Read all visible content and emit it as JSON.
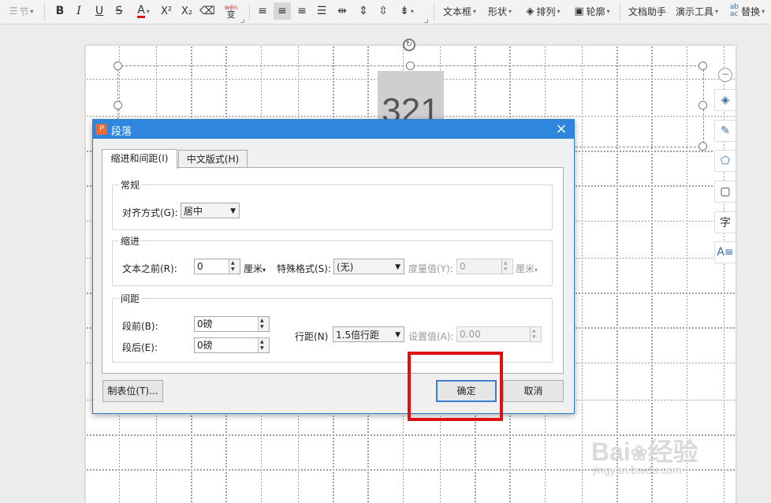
{
  "toolbar": {
    "section_label": "节",
    "bold": "B",
    "italic": "I",
    "underline": "U",
    "strike": "S",
    "font_color": "A",
    "superscript": "X²",
    "subscript": "X₂",
    "pinyin_top": "wén",
    "pinyin_bottom": "变",
    "textbox": "文本框",
    "shape": "形状",
    "arrange": "排列",
    "outline": "轮廓",
    "doc_helper": "文档助手",
    "present_tools": "演示工具",
    "replace": "替换"
  },
  "slide": {
    "text_box_content": "321"
  },
  "dialog": {
    "title": "段落",
    "close_glyph": "×",
    "tabs": [
      {
        "label": "缩进和间距(I)",
        "active": true
      },
      {
        "label": "中文版式(H)",
        "active": false
      }
    ],
    "general": {
      "title": "常规",
      "align_label": "对齐方式(G):",
      "align_value": "居中"
    },
    "indent": {
      "title": "缩进",
      "before_label": "文本之前(R):",
      "before_value": "0",
      "before_unit": "厘米",
      "special_label": "特殊格式(S):",
      "special_value": "(无)",
      "measure_label": "度量值(Y):",
      "measure_value": "0",
      "measure_unit": "厘米"
    },
    "spacing": {
      "title": "间距",
      "before_label": "段前(B):",
      "before_value": "0磅",
      "after_label": "段后(E):",
      "after_value": "0磅",
      "line_label": "行距(N)",
      "line_value": "1.5倍行距",
      "setting_label": "设置值(A):",
      "setting_value": "0.00"
    },
    "tabs_button": "制表位(T)...",
    "ok_button": "确定",
    "cancel_button": "取消"
  },
  "watermark": {
    "brand": "Bai",
    "brand_cn": "经验",
    "url": "jingyan.baidu.com"
  },
  "colors": {
    "titlebar": "#2f86dd",
    "highlight": "#e01010",
    "accent": "#3c7fd1"
  }
}
